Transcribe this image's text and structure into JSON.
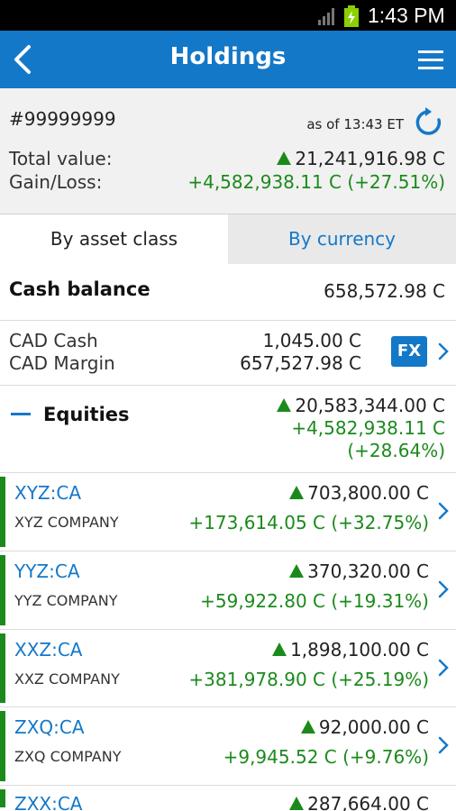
{
  "status_bar": {
    "time": "1:43 PM",
    "icons": [
      "signal-icon",
      "battery-charging-icon"
    ]
  },
  "app_bar": {
    "title": "Holdings",
    "back_icon": "chevron-left-icon",
    "menu_icon": "hamburger-menu-icon"
  },
  "summary": {
    "account": "#99999999",
    "as_of": "as of 13:43 ET",
    "total_value_label": "Total value:",
    "total_value": "21,241,916.98 C",
    "gain_loss_label": "Gain/Loss:",
    "gain_loss": "+4,582,938.11 C (+27.51%)"
  },
  "tabs": [
    {
      "label": "By asset class",
      "active": true
    },
    {
      "label": "By currency",
      "active": false
    }
  ],
  "cash": {
    "title": "Cash balance",
    "value": "658,572.98 C",
    "lines": [
      {
        "label": "CAD Cash",
        "value": "1,045.00 C"
      },
      {
        "label": "CAD Margin",
        "value": "657,527.98 C"
      }
    ],
    "fx_label": "FX"
  },
  "equities": {
    "title": "Equities",
    "value": "20,583,344.00 C",
    "gain": "+4,582,938.11 C",
    "gain_pct": "(+28.64%)"
  },
  "holdings": [
    {
      "symbol": "XYZ:CA",
      "name": "XYZ COMPANY",
      "value": "703,800.00 C",
      "gain": "+173,614.05 C (+32.75%)"
    },
    {
      "symbol": "YYZ:CA",
      "name": "YYZ COMPANY",
      "value": "370,320.00 C",
      "gain": "+59,922.80 C (+19.31%)"
    },
    {
      "symbol": "XXZ:CA",
      "name": "XXZ COMPANY",
      "value": "1,898,100.00 C",
      "gain": "+381,978.90 C (+25.19%)"
    },
    {
      "symbol": "ZXQ:CA",
      "name": "ZXQ COMPANY",
      "value": "92,000.00 C",
      "gain": "+9,945.52 C (+9.76%)"
    },
    {
      "symbol": "ZXX:CA",
      "name": "",
      "value": "287,664.00 C",
      "gain": ""
    }
  ],
  "colors": {
    "primary": "#1478c8",
    "gain": "#1b8a1b",
    "statusbar": "#000000"
  }
}
